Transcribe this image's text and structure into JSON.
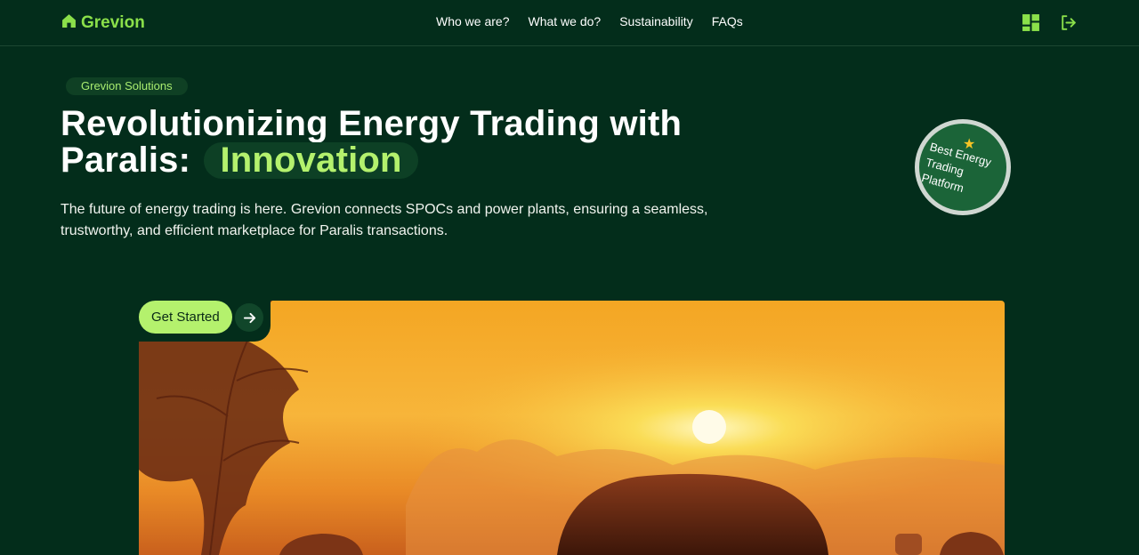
{
  "brand": {
    "name": "Grevion",
    "icon": "home-icon"
  },
  "nav": {
    "links": [
      "Who we are?",
      "What we do?",
      "Sustainability",
      "FAQs"
    ],
    "icons": [
      "dashboard-grid-icon",
      "logout-icon"
    ]
  },
  "hero": {
    "tag": "Grevion Solutions",
    "headline_line1": "Revolutionizing Energy Trading with",
    "headline_line2": "Paralis:",
    "headline_accent": "Innovation",
    "subtitle": "The future of energy trading is here. Grevion connects SPOCs and power plants, ensuring a seamless, trustworthy, and efficient marketplace for Paralis transactions.",
    "badge": {
      "icon": "star-icon",
      "line1": "Best Energy",
      "line2": "Trading",
      "line3": "Platform"
    },
    "cta_label": "Get Started",
    "cta_icon": "arrow-right-icon",
    "image": "sunset-field-hay-bales"
  },
  "colors": {
    "background": "#032d1b",
    "accent": "#b4f16d",
    "brand_green": "#8be04a",
    "badge_green": "#1b6438"
  }
}
